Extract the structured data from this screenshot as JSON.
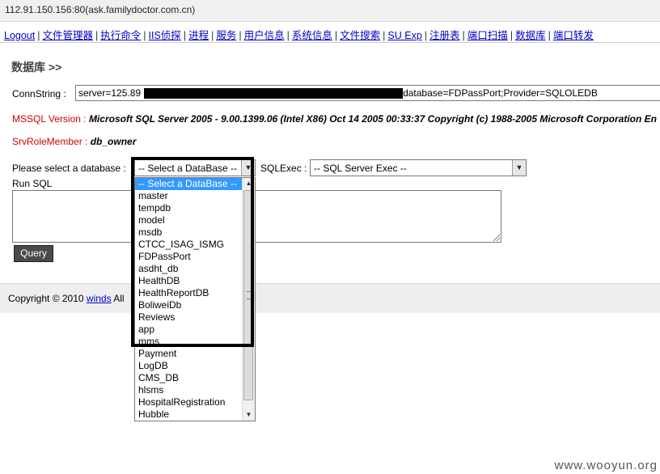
{
  "window": {
    "title": "112.91.150.156:80(ask.familydoctor.com.cn)"
  },
  "nav": {
    "items": [
      "Logout",
      "文件管理器",
      "执行命令",
      "IIS侦探",
      "进程",
      "服务",
      "用户信息",
      "系统信息",
      "文件搜索",
      "SU Exp",
      "注册表",
      "端口扫描",
      "数据库",
      "端口转发"
    ],
    "separator": "|"
  },
  "section": {
    "title": "数据库 >>"
  },
  "conn": {
    "label": "ConnString :",
    "value_prefix": "server=125.89",
    "value_suffix": "database=FDPassPort;Provider=SQLOLEDB"
  },
  "mssql": {
    "label": "MSSQL Version :",
    "value": "Microsoft SQL Server 2005 - 9.00.1399.06 (Intel X86) Oct 14 2005 00:33:37 Copyright (c) 1988-2005 Microsoft Corporation En"
  },
  "role": {
    "label": "SrvRoleMember :",
    "value": "db_owner"
  },
  "db_select": {
    "label": "Please select a database :",
    "selected": "-- Select a DataBase --"
  },
  "sqlexec": {
    "label": "SQLExec :",
    "selected": "-- SQL Server Exec --"
  },
  "runsql": {
    "label": "Run SQL"
  },
  "query_button": "Query",
  "footer": {
    "prefix": "Copyright © 2010",
    "link": "winds",
    "suffix": "All"
  },
  "dropdown": {
    "options": [
      "-- Select a DataBase --",
      "master",
      "tempdb",
      "model",
      "msdb",
      "CTCC_ISAG_ISMG",
      "FDPassPort",
      "asdht_db",
      "HealthDB",
      "HealthReportDB",
      "BoliweiDb",
      "Reviews",
      "app",
      "mms",
      "Payment",
      "LogDB",
      "CMS_DB",
      "hlsms",
      "HospitalRegistration",
      "Hubble"
    ]
  },
  "icons": {
    "dropdown_arrow": "▼",
    "scroll_up": "▲",
    "scroll_down": "▼"
  },
  "colors": {
    "link": "#0000cc",
    "label_red": "#d00000",
    "highlight": "#3399ff"
  },
  "watermark": "www.wooyun.org"
}
